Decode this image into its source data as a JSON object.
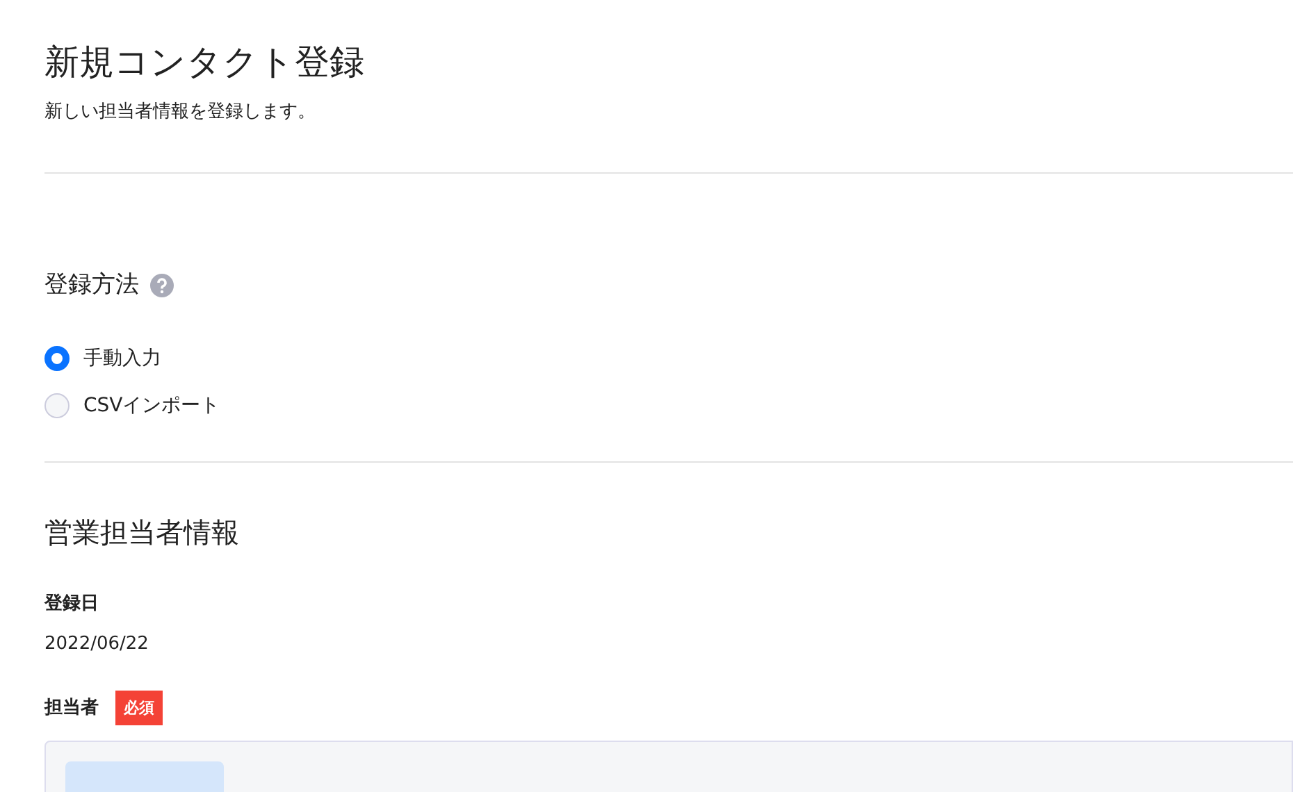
{
  "page": {
    "title": "新規コンタクト登録",
    "subtitle": "新しい担当者情報を登録します。"
  },
  "method": {
    "heading": "登録方法",
    "options": [
      {
        "label": "手動入力",
        "selected": true
      },
      {
        "label": "CSVインポート",
        "selected": false
      }
    ]
  },
  "sales": {
    "heading": "営業担当者情報",
    "fields": [
      {
        "kind": "text",
        "label": "登録日",
        "value": "2022/06/22"
      },
      {
        "kind": "picker",
        "label": "担当者",
        "required_badge": "必須"
      }
    ]
  }
}
